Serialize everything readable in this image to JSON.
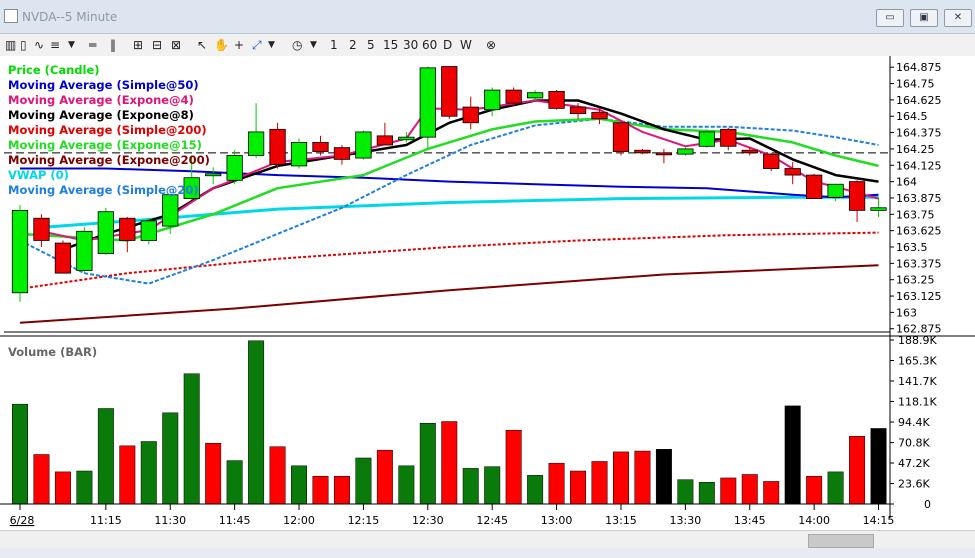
{
  "window": {
    "title": "NVDA--5 Minute",
    "controls": {
      "minimize": "▭",
      "restore": "▣",
      "close": "✕"
    }
  },
  "toolbar": {
    "timeframes": [
      "1",
      "2",
      "5",
      "15",
      "30",
      "60",
      "D",
      "W"
    ]
  },
  "price_legend": [
    {
      "text": "Price (Candle)",
      "color": "#00dd00"
    },
    {
      "text": "Moving Average (Simple@50)",
      "color": "#0000cc"
    },
    {
      "text": "Moving Average (Expone@4)",
      "color": "#e0157a"
    },
    {
      "text": "Moving Average (Expone@8)",
      "color": "#000000"
    },
    {
      "text": "Moving Average (Simple@200)",
      "color": "#e00000"
    },
    {
      "text": "Moving Average (Expone@15)",
      "color": "#22dd22"
    },
    {
      "text": "Moving Average (Expone@200)",
      "color": "#7b0000"
    },
    {
      "text": "VWAP (0)",
      "color": "#00d8e8"
    },
    {
      "text": "Moving Average (Simple@20)",
      "color": "#1e7fe0"
    }
  ],
  "volume_legend": "Volume (BAR)",
  "chart_data": [
    {
      "type": "candlestick",
      "symbol": "NVDA",
      "timeframe": "5 Minute",
      "ylim": [
        162.85,
        164.93
      ],
      "yticks": [
        "164.875",
        "164.75",
        "164.625",
        "164.5",
        "164.375",
        "164.25",
        "164.125",
        "164",
        "163.875",
        "163.75",
        "163.625",
        "163.5",
        "163.375",
        "163.25",
        "163.125",
        "163",
        "162.875"
      ],
      "yticks_values": [
        164.875,
        164.75,
        164.625,
        164.5,
        164.375,
        164.25,
        164.125,
        164,
        163.875,
        163.75,
        163.625,
        163.5,
        163.375,
        163.25,
        163.125,
        163,
        162.875
      ],
      "x_labels": [
        "6/28",
        "11:15",
        "11:30",
        "11:45",
        "12:00",
        "12:15",
        "12:30",
        "12:45",
        "13:00",
        "13:15",
        "13:30",
        "13:45",
        "14:00",
        "14:15"
      ],
      "x_label_bar_index": [
        0,
        4,
        7,
        10,
        13,
        16,
        19,
        22,
        25,
        28,
        31,
        34,
        37,
        40
      ],
      "reference_line": 164.22,
      "candles": [
        {
          "o": 163.15,
          "h": 163.82,
          "l": 163.08,
          "c": 163.78
        },
        {
          "o": 163.72,
          "h": 163.75,
          "l": 163.5,
          "c": 163.55
        },
        {
          "o": 163.53,
          "h": 163.55,
          "l": 163.3,
          "c": 163.3
        },
        {
          "o": 163.32,
          "h": 163.65,
          "l": 163.3,
          "c": 163.62
        },
        {
          "o": 163.45,
          "h": 163.8,
          "l": 163.44,
          "c": 163.77
        },
        {
          "o": 163.72,
          "h": 163.73,
          "l": 163.46,
          "c": 163.55
        },
        {
          "o": 163.55,
          "h": 163.72,
          "l": 163.52,
          "c": 163.7
        },
        {
          "o": 163.66,
          "h": 163.9,
          "l": 163.6,
          "c": 163.9
        },
        {
          "o": 163.87,
          "h": 164.2,
          "l": 163.86,
          "c": 164.03
        },
        {
          "o": 164.06,
          "h": 164.11,
          "l": 163.98,
          "c": 164.06
        },
        {
          "o": 164.01,
          "h": 164.24,
          "l": 163.98,
          "c": 164.2
        },
        {
          "o": 164.2,
          "h": 164.6,
          "l": 164.18,
          "c": 164.38
        },
        {
          "o": 164.4,
          "h": 164.45,
          "l": 164.1,
          "c": 164.13
        },
        {
          "o": 164.12,
          "h": 164.33,
          "l": 164.1,
          "c": 164.3
        },
        {
          "o": 164.3,
          "h": 164.35,
          "l": 164.2,
          "c": 164.23
        },
        {
          "o": 164.26,
          "h": 164.28,
          "l": 164.13,
          "c": 164.17
        },
        {
          "o": 164.18,
          "h": 164.39,
          "l": 164.17,
          "c": 164.38
        },
        {
          "o": 164.35,
          "h": 164.45,
          "l": 164.28,
          "c": 164.28
        },
        {
          "o": 164.32,
          "h": 164.38,
          "l": 164.3,
          "c": 164.34
        },
        {
          "o": 164.34,
          "h": 164.88,
          "l": 164.25,
          "c": 164.87
        },
        {
          "o": 164.88,
          "h": 164.88,
          "l": 164.48,
          "c": 164.5
        },
        {
          "o": 164.57,
          "h": 164.65,
          "l": 164.4,
          "c": 164.45
        },
        {
          "o": 164.55,
          "h": 164.72,
          "l": 164.5,
          "c": 164.7
        },
        {
          "o": 164.7,
          "h": 164.72,
          "l": 164.58,
          "c": 164.6
        },
        {
          "o": 164.64,
          "h": 164.7,
          "l": 164.62,
          "c": 164.68
        },
        {
          "o": 164.69,
          "h": 164.7,
          "l": 164.55,
          "c": 164.56
        },
        {
          "o": 164.57,
          "h": 164.6,
          "l": 164.48,
          "c": 164.52
        },
        {
          "o": 164.53,
          "h": 164.56,
          "l": 164.44,
          "c": 164.48
        },
        {
          "o": 164.45,
          "h": 164.45,
          "l": 164.2,
          "c": 164.23
        },
        {
          "o": 164.24,
          "h": 164.25,
          "l": 164.21,
          "c": 164.22
        },
        {
          "o": 164.22,
          "h": 164.25,
          "l": 164.14,
          "c": 164.21
        },
        {
          "o": 164.21,
          "h": 164.26,
          "l": 164.2,
          "c": 164.25
        },
        {
          "o": 164.27,
          "h": 164.4,
          "l": 164.26,
          "c": 164.38
        },
        {
          "o": 164.4,
          "h": 164.41,
          "l": 164.24,
          "c": 164.27
        },
        {
          "o": 164.24,
          "h": 164.26,
          "l": 164.2,
          "c": 164.22
        },
        {
          "o": 164.21,
          "h": 164.22,
          "l": 164.08,
          "c": 164.1
        },
        {
          "o": 164.1,
          "h": 164.15,
          "l": 163.98,
          "c": 164.05
        },
        {
          "o": 164.05,
          "h": 164.06,
          "l": 163.87,
          "c": 163.87
        },
        {
          "o": 163.88,
          "h": 163.98,
          "l": 163.85,
          "c": 163.98
        },
        {
          "o": 164.0,
          "h": 164.01,
          "l": 163.69,
          "c": 163.78
        },
        {
          "o": 163.78,
          "h": 163.88,
          "l": 163.73,
          "c": 163.8
        }
      ],
      "moving_averages": {
        "sma50": [
          [
            0,
            164.1
          ],
          [
            4,
            164.1
          ],
          [
            8,
            164.08
          ],
          [
            12,
            164.05
          ],
          [
            16,
            164.03
          ],
          [
            20,
            164.0
          ],
          [
            24,
            163.98
          ],
          [
            28,
            163.96
          ],
          [
            32,
            163.95
          ],
          [
            36,
            163.9
          ],
          [
            38,
            163.88
          ],
          [
            40,
            163.9
          ]
        ],
        "ema4": [
          [
            1,
            163.62
          ],
          [
            3,
            163.55
          ],
          [
            6,
            163.63
          ],
          [
            9,
            163.95
          ],
          [
            12,
            164.15
          ],
          [
            15,
            164.2
          ],
          [
            18,
            164.33
          ],
          [
            19,
            164.56
          ],
          [
            21,
            164.55
          ],
          [
            24,
            164.62
          ],
          [
            27,
            164.55
          ],
          [
            29,
            164.38
          ],
          [
            31,
            164.27
          ],
          [
            33,
            164.32
          ],
          [
            35,
            164.2
          ],
          [
            37,
            164.0
          ],
          [
            38,
            163.96
          ],
          [
            40,
            163.87
          ]
        ],
        "ema8": [
          [
            2,
            163.48
          ],
          [
            4,
            163.6
          ],
          [
            7,
            163.75
          ],
          [
            9,
            163.95
          ],
          [
            12,
            164.12
          ],
          [
            15,
            164.2
          ],
          [
            18,
            164.28
          ],
          [
            20,
            164.45
          ],
          [
            22,
            164.55
          ],
          [
            24,
            164.62
          ],
          [
            26,
            164.62
          ],
          [
            28,
            164.52
          ],
          [
            30,
            164.4
          ],
          [
            32,
            164.32
          ],
          [
            34,
            164.33
          ],
          [
            36,
            164.17
          ],
          [
            38,
            164.05
          ],
          [
            40,
            164.0
          ]
        ],
        "sma200": [
          [
            0,
            163.18
          ],
          [
            5,
            163.3
          ],
          [
            12,
            163.41
          ],
          [
            20,
            163.5
          ],
          [
            26,
            163.55
          ],
          [
            33,
            163.59
          ],
          [
            40,
            163.61
          ]
        ],
        "ema15": [
          [
            0,
            163.6
          ],
          [
            5,
            163.55
          ],
          [
            9,
            163.75
          ],
          [
            12,
            163.95
          ],
          [
            16,
            164.05
          ],
          [
            19,
            164.25
          ],
          [
            22,
            164.4
          ],
          [
            24,
            164.46
          ],
          [
            27,
            164.48
          ],
          [
            30,
            164.4
          ],
          [
            33,
            164.38
          ],
          [
            36,
            164.3
          ],
          [
            38,
            164.2
          ],
          [
            40,
            164.12
          ]
        ],
        "ema200": [
          [
            0,
            162.92
          ],
          [
            10,
            163.03
          ],
          [
            20,
            163.17
          ],
          [
            30,
            163.29
          ],
          [
            40,
            163.36
          ]
        ],
        "vwap": [
          [
            1,
            163.65
          ],
          [
            6,
            163.71
          ],
          [
            12,
            163.79
          ],
          [
            20,
            163.84
          ],
          [
            28,
            163.87
          ],
          [
            36,
            163.88
          ],
          [
            40,
            163.88
          ]
        ],
        "sma20": [
          [
            0,
            163.55
          ],
          [
            3,
            163.3
          ],
          [
            6,
            163.22
          ],
          [
            9,
            163.4
          ],
          [
            12,
            163.6
          ],
          [
            15,
            163.8
          ],
          [
            18,
            164.05
          ],
          [
            21,
            164.28
          ],
          [
            24,
            164.43
          ],
          [
            27,
            164.48
          ],
          [
            30,
            164.42
          ],
          [
            33,
            164.42
          ],
          [
            36,
            164.39
          ],
          [
            38,
            164.34
          ],
          [
            40,
            164.28
          ]
        ]
      }
    },
    {
      "type": "bar",
      "title": "Volume (BAR)",
      "ylim": [
        0,
        188900
      ],
      "yticks": [
        "188.9K",
        "165.3K",
        "141.7K",
        "118.1K",
        "94.4K",
        "70.8K",
        "47.2K",
        "23.6K",
        "0"
      ],
      "yticks_values": [
        188900,
        165300,
        141700,
        118100,
        94400,
        70800,
        47200,
        23600,
        0
      ],
      "values": [
        115000,
        57000,
        37000,
        38000,
        110000,
        67000,
        72000,
        105000,
        150000,
        70000,
        50000,
        188000,
        66000,
        44000,
        32000,
        32000,
        53000,
        62000,
        44000,
        93000,
        95000,
        41000,
        43000,
        85000,
        33000,
        47000,
        38000,
        49000,
        60000,
        61000,
        63000,
        28000,
        25000,
        30000,
        34000,
        26000,
        113000,
        32000,
        37000,
        78000,
        87000
      ],
      "colors": [
        "green",
        "red",
        "red",
        "green",
        "green",
        "red",
        "green",
        "green",
        "green",
        "red",
        "green",
        "green",
        "red",
        "green",
        "red",
        "red",
        "green",
        "red",
        "green",
        "green",
        "red",
        "green",
        "green",
        "red",
        "green",
        "red",
        "red",
        "red",
        "red",
        "red",
        "black",
        "green",
        "green",
        "red",
        "red",
        "red",
        "black",
        "red",
        "green",
        "red",
        "black"
      ]
    }
  ]
}
